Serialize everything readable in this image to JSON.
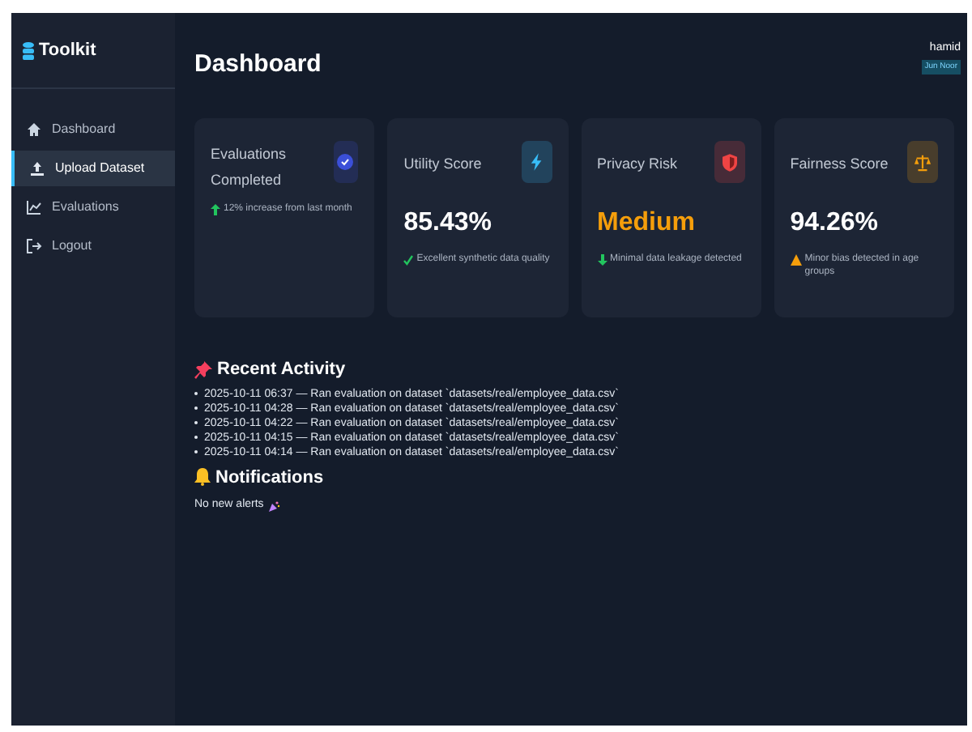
{
  "sidebar": {
    "brand": "Toolkit",
    "items": [
      {
        "label": "Dashboard",
        "kind": "home",
        "selected": false
      },
      {
        "label": "Upload Dataset",
        "kind": "upload",
        "selected": true
      },
      {
        "label": "Evaluations",
        "kind": "chart",
        "selected": false
      },
      {
        "label": "Logout",
        "kind": "logout",
        "selected": false
      }
    ]
  },
  "header": {
    "title": "Dashboard",
    "user": "hamid",
    "badge": "Jun Noor"
  },
  "cards": [
    {
      "title": "Evaluations Completed",
      "kind": "check",
      "color": "#3b4fd8",
      "note": {
        "kind": "up",
        "text": "12% increase from last month"
      }
    },
    {
      "title": "Utility Score",
      "kind": "bolt",
      "color": "#38bdf8",
      "value": {
        "text": "85.43%",
        "color": "#ffffff"
      },
      "note": {
        "kind": "check",
        "text": "Excellent synthetic data quality"
      }
    },
    {
      "title": "Privacy Risk",
      "kind": "shield",
      "color": "#ef4444",
      "value": {
        "text": "Medium",
        "color": "#f59e0b"
      },
      "note": {
        "kind": "down",
        "text": "Minimal data leakage detected"
      }
    },
    {
      "title": "Fairness Score",
      "kind": "scale",
      "color": "#f59e0b",
      "value": {
        "text": "94.26%",
        "color": "#ffffff"
      },
      "note": {
        "kind": "warn",
        "text": "Minor bias detected in age groups"
      }
    }
  ],
  "recent_activity": {
    "title": "Recent Activity",
    "items": [
      "2025-10-11 06:37 — Ran evaluation on dataset `datasets/real/employee_data.csv`",
      "2025-10-11 04:28 — Ran evaluation on dataset `datasets/real/employee_data.csv`",
      "2025-10-11 04:22 — Ran evaluation on dataset `datasets/real/employee_data.csv`",
      "2025-10-11 04:15 — Ran evaluation on dataset `datasets/real/employee_data.csv`",
      "2025-10-11 04:14 — Ran evaluation on dataset `datasets/real/employee_data.csv`"
    ]
  },
  "notifications": {
    "title": "Notifications",
    "message": "No new alerts"
  }
}
